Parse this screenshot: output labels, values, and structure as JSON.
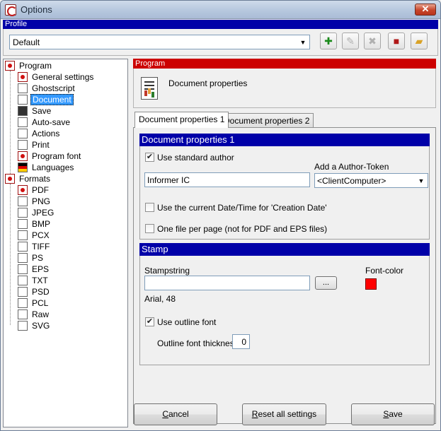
{
  "window": {
    "title": "Options",
    "close": "✕"
  },
  "profile": {
    "header": "Profile",
    "selected": "Default",
    "toolbar_icons": [
      "add-profile-icon",
      "rename-profile-icon",
      "delete-profile-icon",
      "save-profile-icon",
      "open-folder-icon"
    ]
  },
  "tree": {
    "program": "Program",
    "program_items": [
      "General settings",
      "Ghostscript",
      "Document",
      "Save",
      "Auto-save",
      "Actions",
      "Print",
      "Program font",
      "Languages"
    ],
    "formats": "Formats",
    "format_items": [
      "PDF",
      "PNG",
      "JPEG",
      "BMP",
      "PCX",
      "TIFF",
      "PS",
      "EPS",
      "TXT",
      "PSD",
      "PCL",
      "Raw",
      "SVG"
    ],
    "selected": "Document"
  },
  "program_panel": {
    "header": "Program",
    "title": "Document properties"
  },
  "tabs": [
    "Document properties 1",
    "Document properties 2"
  ],
  "docprops": {
    "header": "Document properties 1",
    "use_standard_author": {
      "label": "Use standard author",
      "checked": true
    },
    "author_value": "Informer IC",
    "author_token_label": "Add a Author-Token",
    "author_token_value": "<ClientComputer>",
    "use_current_date": {
      "label": "Use the current Date/Time for 'Creation Date'",
      "checked": false
    },
    "one_file_per_page": {
      "label": "One file per page (not for PDF and EPS files)",
      "checked": false
    }
  },
  "stamp": {
    "header": "Stamp",
    "stampstring_label": "Stampstring",
    "stampstring_value": "",
    "browse_label": "...",
    "font_info": "Arial, 48",
    "font_color_label": "Font-color",
    "font_color": "#ff0000",
    "use_outline_font": {
      "label": "Use outline font",
      "checked": true
    },
    "outline_thickness_label": "Outline font thickness",
    "outline_thickness_value": "0"
  },
  "buttons": {
    "cancel": "Cancel",
    "reset": "Reset all settings",
    "save": "Save"
  }
}
